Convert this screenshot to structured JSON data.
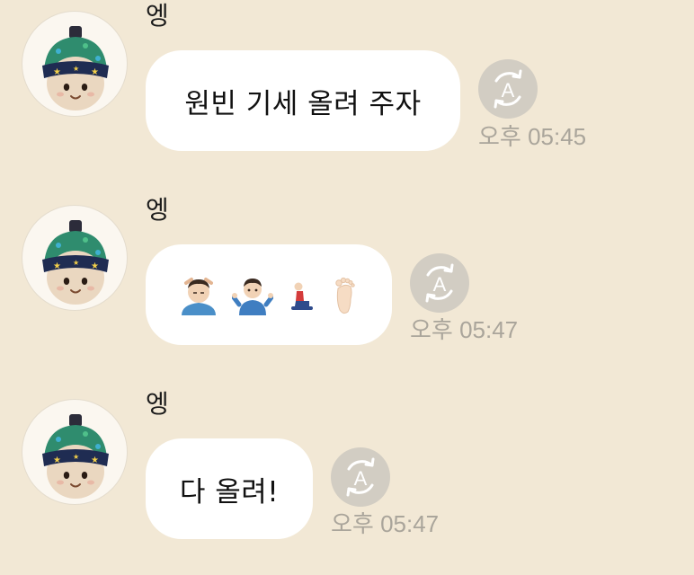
{
  "colors": {
    "background": "#f2e8d5",
    "bubble": "#ffffff",
    "timestamp": "#aaa59b",
    "translate_button": "#d2cdc3"
  },
  "messages": [
    {
      "sender": "엥",
      "text": "원빈 기세 올려 주자",
      "time": "오후 05:45",
      "avatar_icon": "beanie-character-avatar-icon",
      "action_icon": "auto-translate-a-icon"
    },
    {
      "sender": "엥",
      "emojis": [
        "man-getting-massage",
        "man-shrugging",
        "person-kneeling",
        "foot"
      ],
      "time": "오후 05:47",
      "avatar_icon": "beanie-character-avatar-icon",
      "action_icon": "auto-translate-a-icon"
    },
    {
      "sender": "엥",
      "text": "다 올려!",
      "time": "오후 05:47",
      "avatar_icon": "beanie-character-avatar-icon",
      "action_icon": "auto-translate-a-icon"
    }
  ]
}
